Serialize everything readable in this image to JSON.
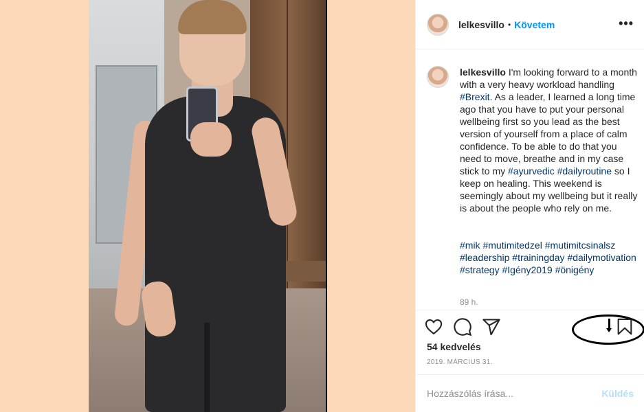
{
  "post": {
    "username": "lelkesvillo",
    "follow_label": "Követem",
    "separator": "•",
    "more_label": "•••"
  },
  "caption": {
    "username": "lelkesvillo",
    "text_1": " I'm looking forward to a month with a very heavy workload handling ",
    "tag_brexit": "#Brexit",
    "text_2": ". As a leader, I learned a long time ago that you have to put your personal wellbeing first so you lead as the best version of yourself from a place of calm confidence. To be able to do that you need to move, breathe and in my case stick to my ",
    "tag_ayurvedic": "#ayurvedic",
    "space": " ",
    "tag_dailyroutine": "#dailyroutine",
    "text_3": " so I keep on healing. This weekend is seemingly about my wellbeing but it really is about the people who rely on me.",
    "hashtags": [
      "#mik",
      "#mutimitedzel",
      "#mutimitcsinalsz",
      "#leadership",
      "#trainingday",
      "#dailymotivation",
      "#strategy",
      "#Igény2019",
      "#önigény"
    ],
    "time_ago": "89 h."
  },
  "actions": {
    "like_icon": "heart-icon",
    "comment_icon": "comment-icon",
    "share_icon": "paper-plane-icon",
    "save_icon": "bookmark-icon"
  },
  "likes": "54 kedvelés",
  "date": "2019. MÁRCIUS 31.",
  "comment": {
    "placeholder": "Hozzászólás írása...",
    "send_label": "Küldés"
  },
  "colors": {
    "accent": "#0095f6",
    "hashtag": "#00376b",
    "page_bg": "#fcd9b8",
    "muted": "#8e8e8e"
  }
}
